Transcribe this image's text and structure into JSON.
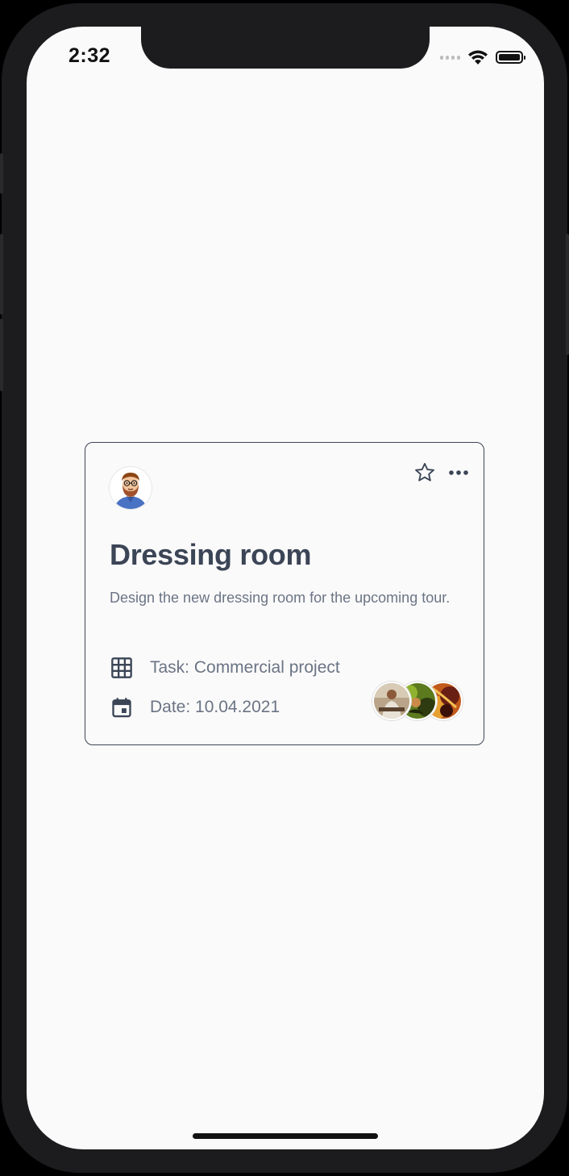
{
  "status_bar": {
    "time": "2:32"
  },
  "card": {
    "title": "Dressing room",
    "description": "Design the new dressing room for the upcoming tour.",
    "task_label": "Task: Commercial project",
    "date_label": "Date: 10.04.2021",
    "owner_avatar_icon": "bearded-man-avatar",
    "star_icon": "star-outline-icon",
    "more_icon": "more-horizontal-icon",
    "task_icon": "grid-icon",
    "date_icon": "calendar-icon",
    "collaborators_count": 3
  },
  "colors": {
    "title": "#3b4556",
    "muted_text": "#6b7485",
    "card_border": "#3d4554",
    "screen_bg": "#fafafa"
  }
}
